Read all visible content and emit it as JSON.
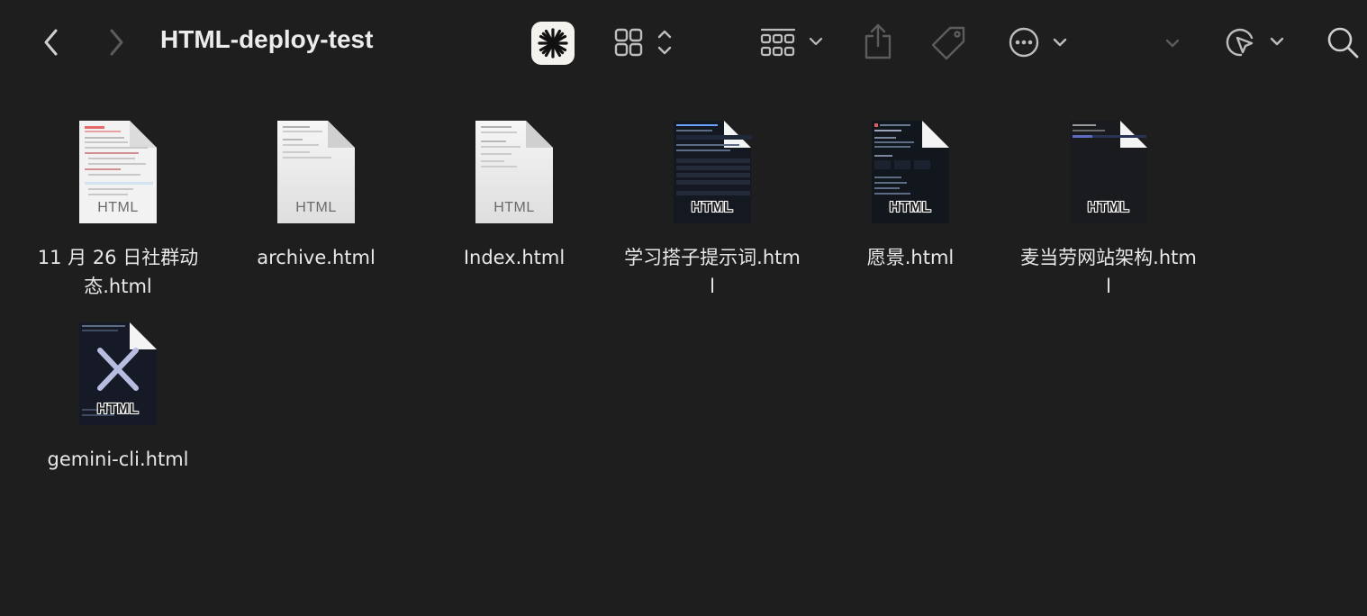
{
  "window": {
    "title": "HTML-deploy-test",
    "background": "#1e1e1e"
  },
  "toolbar": {
    "back": "chevron-left-icon",
    "forward": "chevron-right-icon",
    "app": "asterisk-app-icon",
    "view": "grid-view-icon",
    "group": "group-by-icon",
    "share": "share-icon",
    "tags": "tag-icon",
    "more": "ellipsis-circle-icon",
    "markup": "cursor-markup-icon",
    "search": "search-icon"
  },
  "files": [
    {
      "name": "11 月 26 日社群动态.html",
      "badge": "HTML",
      "style": "light-preview"
    },
    {
      "name": "archive.html",
      "badge": "HTML",
      "style": "light"
    },
    {
      "name": "Index.html",
      "badge": "HTML",
      "style": "light"
    },
    {
      "name": "学习搭子提示词.html",
      "badge": "HTML",
      "style": "dark-table"
    },
    {
      "name": "愿景.html",
      "badge": "HTML",
      "style": "dark-lines"
    },
    {
      "name": "麦当劳网站架构.html",
      "badge": "HTML",
      "style": "dark-plain"
    },
    {
      "name": "gemini-cli.html",
      "badge": "HTML",
      "style": "dark-x"
    }
  ]
}
